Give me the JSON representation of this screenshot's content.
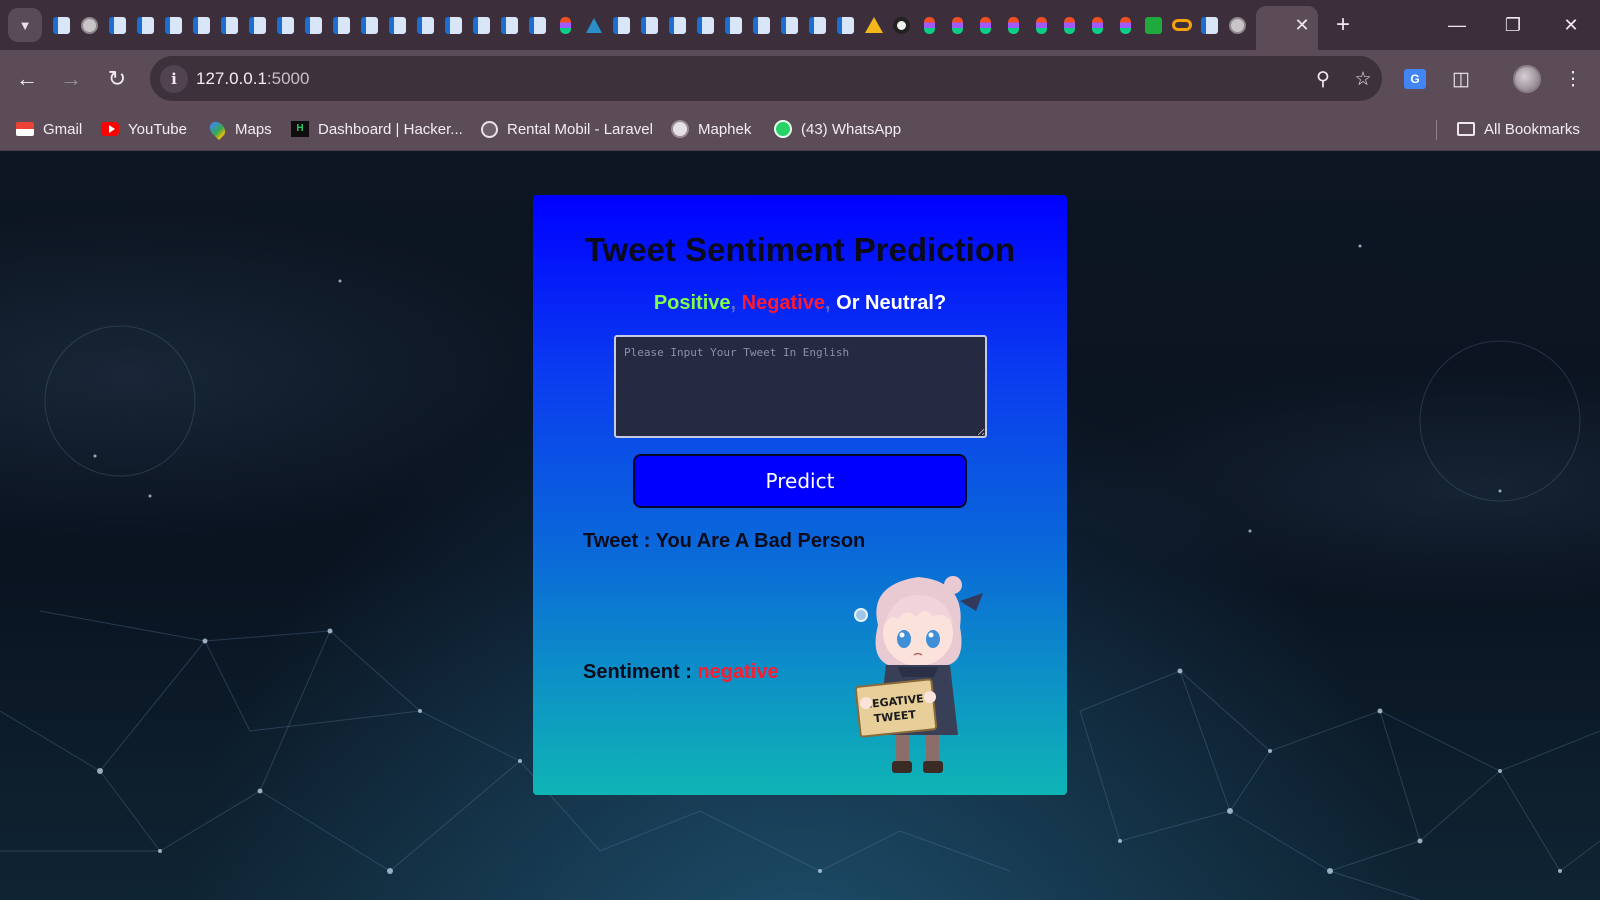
{
  "browser": {
    "address": {
      "host": "127.0.0.1",
      "port": ":5000"
    },
    "bookmarks": [
      {
        "label": "Gmail",
        "icon": "gmail-icon"
      },
      {
        "label": "YouTube",
        "icon": "youtube-icon"
      },
      {
        "label": "Maps",
        "icon": "maps-icon"
      },
      {
        "label": "Dashboard | Hacker...",
        "icon": "hackerrank-icon"
      },
      {
        "label": "Rental Mobil - Laravel",
        "icon": "globe-icon"
      },
      {
        "label": "Maphek",
        "icon": "maphek-icon"
      },
      {
        "label": "(43) WhatsApp",
        "icon": "whatsapp-icon"
      }
    ],
    "all_bookmarks": "All Bookmarks"
  },
  "app": {
    "title": "Tweet Sentiment Prediction",
    "subtitle": {
      "positive": "Positive",
      "comma": ",",
      "negative": "Negative",
      "neutral": "Or Neutral?"
    },
    "input_placeholder": "Please Input Your Tweet In English",
    "input_value": "",
    "predict_label": "Predict",
    "tweet_label": "Tweet : ",
    "tweet_text": "You Are A Bad Person",
    "sentiment_label": "Sentiment : ",
    "sentiment_value": "negative",
    "illustration_sign": {
      "line1": "NEGATIVE",
      "line2": "TWEET"
    }
  },
  "colors": {
    "positive": "#7dff4a",
    "negative": "#ff1a2e",
    "neutral": "#ffffff",
    "button": "#0000ff"
  }
}
